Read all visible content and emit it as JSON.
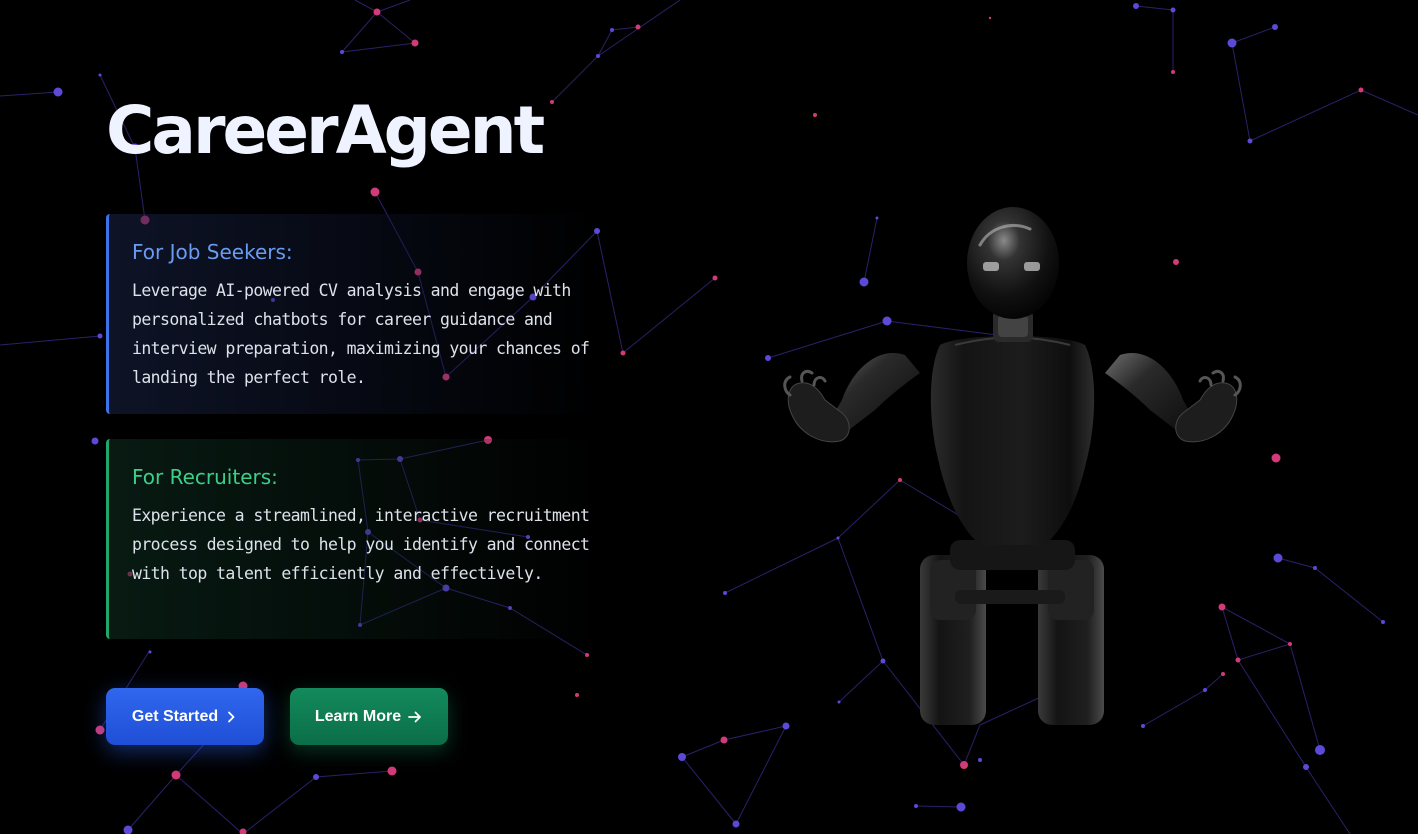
{
  "hero": {
    "title": "CareerAgent"
  },
  "cards": {
    "seekers": {
      "heading": "For Job Seekers:",
      "body": "Leverage AI-powered CV analysis and engage with personalized chatbots for career guidance and interview preparation, maximizing your chances of landing the perfect role.",
      "accent": "#3b73ea"
    },
    "recruiters": {
      "heading": "For Recruiters:",
      "body": "Experience a streamlined, interactive recruitment process designed to help you identify and connect with top talent efficiently and effectively.",
      "accent": "#20a86a"
    }
  },
  "actions": {
    "get_started": {
      "label": "Get Started",
      "icon": "chevron-right-icon",
      "color": "#2f67ee"
    },
    "learn_more": {
      "label": "Learn More",
      "icon": "arrow-right-icon",
      "color": "#138a5c"
    }
  },
  "colors": {
    "background": "#000000",
    "node_blue": "#5b4ad8",
    "node_pink": "#d23a78"
  },
  "illustration": {
    "icon": "robot-icon"
  }
}
